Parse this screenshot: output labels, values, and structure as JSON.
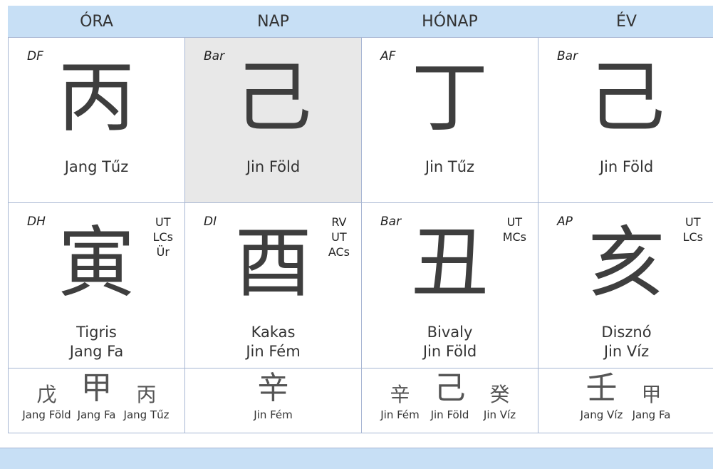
{
  "headers": [
    "ÓRA",
    "NAP",
    "HÓNAP",
    "ÉV"
  ],
  "stems": [
    {
      "tag": "DF",
      "char": "丙",
      "label": "Jang Tűz"
    },
    {
      "tag": "Bar",
      "char": "己",
      "label": "Jin Föld"
    },
    {
      "tag": "AF",
      "char": "丁",
      "label": "Jin Tűz"
    },
    {
      "tag": "Bar",
      "char": "己",
      "label": "Jin Föld"
    }
  ],
  "branches": [
    {
      "tag": "DH",
      "char": "寅",
      "animal": "Tigris",
      "element": "Jang Fa",
      "notes": [
        "UT",
        "LCs",
        "Ür"
      ]
    },
    {
      "tag": "DI",
      "char": "酉",
      "animal": "Kakas",
      "element": "Jin Fém",
      "notes": [
        "RV",
        "UT",
        "ACs"
      ]
    },
    {
      "tag": "Bar",
      "char": "丑",
      "animal": "Bivaly",
      "element": "Jin Föld",
      "notes": [
        "UT",
        "MCs"
      ]
    },
    {
      "tag": "AP",
      "char": "亥",
      "animal": "Disznó",
      "element": "Jin Víz",
      "notes": [
        "UT",
        "LCs"
      ]
    }
  ],
  "hidden_stems": [
    [
      {
        "char": "戊",
        "label": "Jang Föld"
      },
      {
        "char": "甲",
        "label": "Jang Fa"
      },
      {
        "char": "丙",
        "label": "Jang Tűz"
      }
    ],
    [
      {
        "char": "辛",
        "label": "Jin Fém"
      }
    ],
    [
      {
        "char": "辛",
        "label": "Jin Fém"
      },
      {
        "char": "己",
        "label": "Jin Föld"
      },
      {
        "char": "癸",
        "label": "Jin Víz"
      }
    ],
    [
      {
        "char": "壬",
        "label": "Jang Víz"
      },
      {
        "char": "甲",
        "label": "Jang Fa"
      }
    ]
  ],
  "colors": {
    "header_bg": "#c7dff5",
    "day_highlight": "#e8e8e8",
    "border": "#a7b6d3"
  }
}
